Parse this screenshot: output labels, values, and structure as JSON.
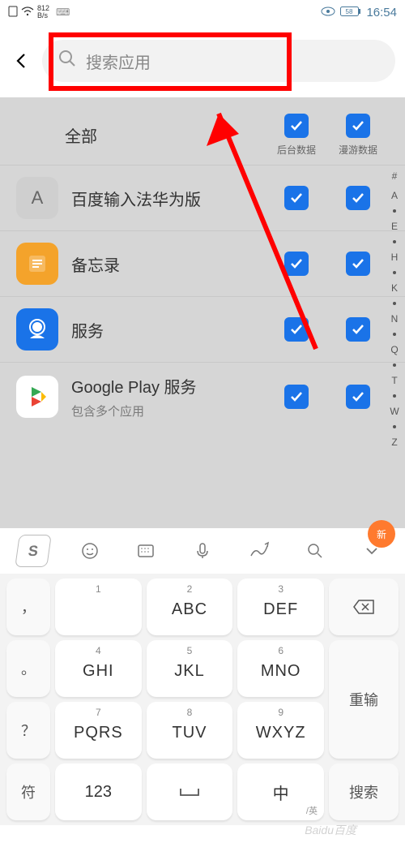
{
  "status": {
    "speed_top": "812",
    "speed_unit": "B/s",
    "time": "16:54"
  },
  "search": {
    "placeholder": "搜索应用"
  },
  "columns": {
    "background": "后台数据",
    "roaming": "漫游数据"
  },
  "header_label": "全部",
  "apps": [
    {
      "name": "百度输入法华为版",
      "sub": "",
      "icon_letter": "A",
      "icon_bg": "#cfcfcf",
      "icon_fg": "#666"
    },
    {
      "name": "备忘录",
      "sub": "",
      "icon_letter": "",
      "icon_bg": "#f4a32b",
      "icon_fg": "#fff"
    },
    {
      "name": "服务",
      "sub": "",
      "icon_letter": "",
      "icon_bg": "#1a73e8",
      "icon_fg": "#fff"
    },
    {
      "name": "Google Play 服务",
      "sub": "包含多个应用",
      "icon_letter": "",
      "icon_bg": "#ffffff",
      "icon_fg": "#fff"
    }
  ],
  "index_letters": [
    "#",
    "A",
    "●",
    "E",
    "H",
    "K",
    "N",
    "Q",
    "T",
    "W",
    "Z"
  ],
  "keyboard": {
    "new_badge": "新",
    "rows": [
      {
        "side": "，",
        "k": [
          {
            "n": "1",
            "m": ""
          },
          {
            "n": "2",
            "m": "ABC"
          },
          {
            "n": "3",
            "m": "DEF"
          }
        ],
        "right": "backspace"
      },
      {
        "side": "。",
        "k": [
          {
            "n": "4",
            "m": "GHI"
          },
          {
            "n": "5",
            "m": "JKL"
          },
          {
            "n": "6",
            "m": "MNO"
          }
        ],
        "right": "重输"
      },
      {
        "side": "？",
        "k": [
          {
            "n": "7",
            "m": "PQRS"
          },
          {
            "n": "8",
            "m": "TUV"
          },
          {
            "n": "9",
            "m": "WXYZ"
          }
        ],
        "right": ""
      }
    ],
    "bottom": {
      "side": "符",
      "k1": "123",
      "k2_icon": "space",
      "k3": "中",
      "k3_sub": "英",
      "right": "搜索"
    }
  },
  "watermark": "Baidu百度"
}
